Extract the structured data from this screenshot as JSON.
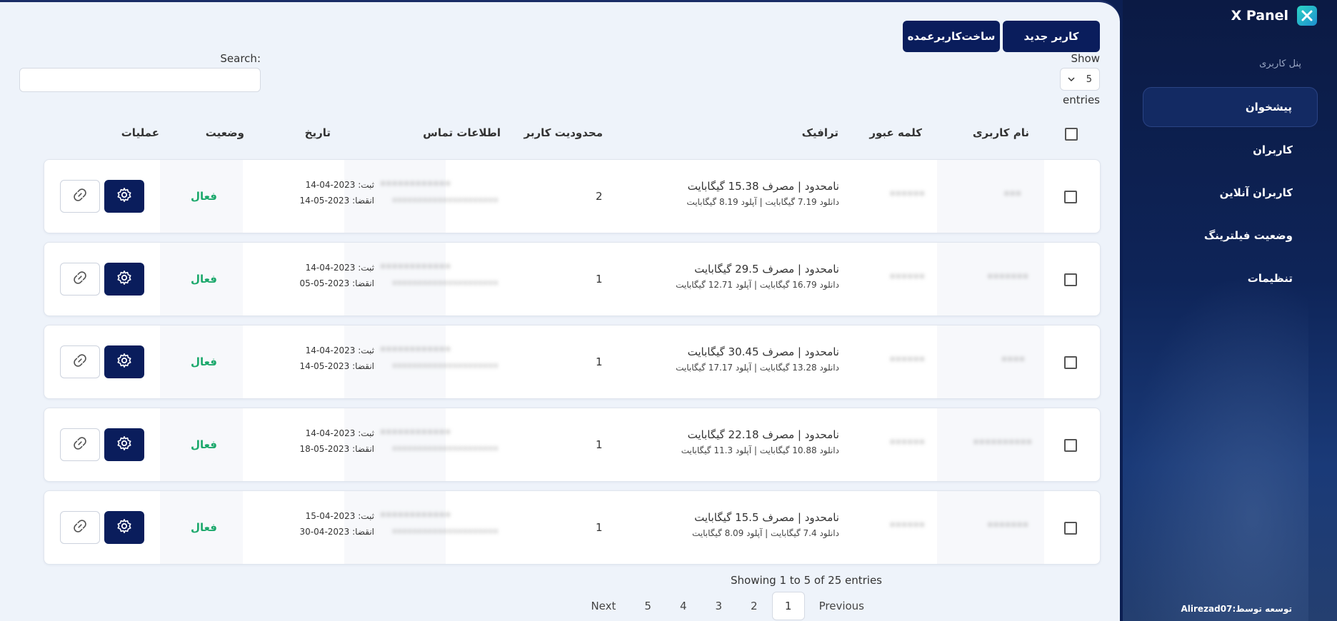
{
  "brand": {
    "title": "X Panel",
    "logo_icon": "xpanel-logo-icon"
  },
  "sidebar": {
    "section_label": "پنل کاربری",
    "items": [
      {
        "label": "پیشخوان",
        "active": true
      },
      {
        "label": "کاربران",
        "active": false
      },
      {
        "label": "کاربران آنلاین",
        "active": false
      },
      {
        "label": "وضعیت فیلترینگ",
        "active": false
      },
      {
        "label": "تنظیمات",
        "active": false
      }
    ],
    "credit": "توسعه توسط:Alirezad07"
  },
  "toolbar": {
    "new_user_label": "کاربر جدید",
    "bulk_user_label": "ساخت‌کاربرعمده"
  },
  "length_menu": {
    "show_label": "Show",
    "value": "5",
    "entries_label": "entries"
  },
  "search": {
    "label": "Search:",
    "value": "",
    "placeholder": ""
  },
  "table": {
    "headers": {
      "username": "نام کاربری",
      "password": "کلمه عبور",
      "traffic": "ترافیک",
      "user_limit": "محدودیت کاربر",
      "contact": "اطلاعات تماس",
      "date": "تاریخ",
      "status": "وضعیت",
      "operations": "عملیات"
    },
    "rows": [
      {
        "traffic_main": "نامحدود | مصرف 15.38 گیگابایت",
        "traffic_detail": "دانلود 7.19 گیگابایت | آپلود 8.19 گیگابایت",
        "user_limit": "2",
        "date_reg": "ثبت: 2023-04-14",
        "date_exp": "انقضا: 2023-05-14",
        "status": "فعال"
      },
      {
        "traffic_main": "نامحدود | مصرف 29.5 گیگابایت",
        "traffic_detail": "دانلود 16.79 گیگابایت | آپلود 12.71 گیگابایت",
        "user_limit": "1",
        "date_reg": "ثبت: 2023-04-14",
        "date_exp": "انقضا: 2023-05-05",
        "status": "فعال"
      },
      {
        "traffic_main": "نامحدود | مصرف 30.45 گیگابایت",
        "traffic_detail": "دانلود 13.28 گیگابایت | آپلود 17.17 گیگابایت",
        "user_limit": "1",
        "date_reg": "ثبت: 2023-04-14",
        "date_exp": "انقضا: 2023-05-14",
        "status": "فعال"
      },
      {
        "traffic_main": "نامحدود | مصرف 22.18 گیگابایت",
        "traffic_detail": "دانلود 10.88 گیگابایت | آپلود 11.3 گیگابایت",
        "user_limit": "1",
        "date_reg": "ثبت: 2023-04-14",
        "date_exp": "انقضا: 2023-05-18",
        "status": "فعال"
      },
      {
        "traffic_main": "نامحدود | مصرف 15.5 گیگابایت",
        "traffic_detail": "دانلود 7.4 گیگابایت | آپلود 8.09 گیگابایت",
        "user_limit": "1",
        "date_reg": "ثبت: 2023-04-15",
        "date_exp": "انقضا: 2023-04-30",
        "status": "فعال"
      }
    ]
  },
  "info": "Showing 1 to 5 of 25 entries",
  "pagination": {
    "previous": "Previous",
    "pages": [
      "1",
      "2",
      "3",
      "4",
      "5"
    ],
    "next": "Next",
    "current": "1"
  },
  "colors": {
    "primary": "#0a1d5c",
    "status_active": "#1ba86b",
    "background": "#eef3fa"
  }
}
